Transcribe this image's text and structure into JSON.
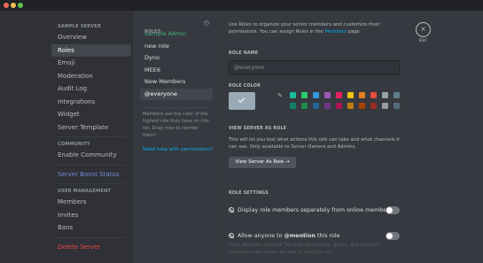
{
  "window": {
    "traffic_lights": [
      "close",
      "minimize",
      "maximize"
    ]
  },
  "sidebar": {
    "section_server": "SAMPLE SERVER",
    "items": [
      {
        "label": "Overview"
      },
      {
        "label": "Roles"
      },
      {
        "label": "Emoji"
      },
      {
        "label": "Moderation"
      },
      {
        "label": "Audit Log"
      },
      {
        "label": "Integrations"
      },
      {
        "label": "Widget"
      },
      {
        "label": "Server Template"
      }
    ],
    "section_community": "COMMUNITY",
    "enable_community": "Enable Community",
    "boost_status": "Server Boost Status",
    "section_users": "USER MANAGEMENT",
    "user_items": [
      {
        "label": "Members"
      },
      {
        "label": "Invites"
      },
      {
        "label": "Bans"
      }
    ],
    "delete_server": "Delete Server"
  },
  "roles_panel": {
    "title": "ROLES",
    "add_icon": "+",
    "roles": [
      {
        "label": "Sample Admin"
      },
      {
        "label": "new role"
      },
      {
        "label": "Dyno"
      },
      {
        "label": "MEE6"
      },
      {
        "label": "New Members"
      },
      {
        "label": "@everyone"
      }
    ],
    "note": "Members use the color of the highest role they have on this list. Drag roles to reorder them!",
    "help_link": "Need help with permissions?"
  },
  "main": {
    "intro_part1": "Use Roles to organize your server members and customize their permissions. You can assign Roles in the ",
    "intro_link": "Members",
    "intro_part2": " page.",
    "role_name_label": "ROLE NAME",
    "role_name_value": "@everyone",
    "role_color_label": "ROLE COLOR",
    "picker_icon": "✎",
    "swatch_colors": [
      "#1abc9c",
      "#2ecc71",
      "#3498db",
      "#9b59b6",
      "#e91e63",
      "#f1c40f",
      "#e67e22",
      "#e74c3c",
      "#95a5a6",
      "#607d8b",
      "#11806a",
      "#1f8b4c",
      "#206694",
      "#71368a",
      "#ad1457",
      "#c27c0e",
      "#a84300",
      "#992d22",
      "#979c9f",
      "#546e7a"
    ],
    "default_color": "#99aab5",
    "view_label": "VIEW SERVER AS ROLE",
    "view_desc": "This will let you test what actions this role can take and what channels it can see. Only available to Server Owners and Admins.",
    "view_button": "View Server As Role →",
    "role_settings_label": "ROLE SETTINGS",
    "setting1": "Display role members separately from online members",
    "setting2_prefix": "Allow anyone to ",
    "setting2_bold": "@mention",
    "setting2_suffix": " this role",
    "faded_note": "Note: Members with the \"Mention @everyone, @here, and All Roles\" permission will always be able to ping this role."
  },
  "close": {
    "icon": "×",
    "label": "ESC"
  }
}
